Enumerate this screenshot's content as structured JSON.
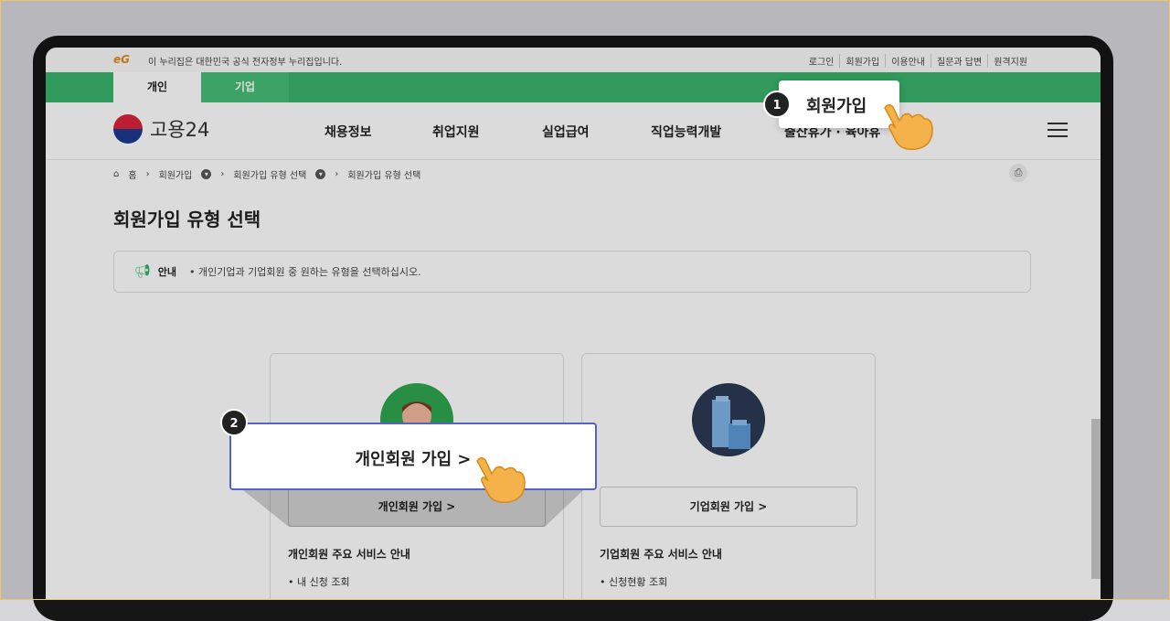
{
  "gov_bar": {
    "logo": "eG",
    "text": "이 누리집은 대한민국 공식 전자정부 누리집입니다.",
    "utility_links": [
      "로그인",
      "회원가입",
      "이용안내",
      "질문과 답변",
      "원격지원"
    ]
  },
  "tabs": [
    {
      "label": "개인",
      "active": true
    },
    {
      "label": "기업",
      "active": false
    }
  ],
  "brand": {
    "name": "고용24"
  },
  "nav": [
    "채용정보",
    "취업지원",
    "실업급여",
    "직업능력개발",
    "출산휴가 · 육아휴"
  ],
  "breadcrumb": [
    "홈",
    "회원가입",
    "회원가입 유형 선택",
    "회원가입 유형 선택"
  ],
  "page_title": "회원가입 유형 선택",
  "notice": {
    "label": "안내",
    "text": "• 개인기업과 기업회원 중 원하는 유형을 선택하십시오."
  },
  "cards": [
    {
      "button": "개인회원 가입 >",
      "service_title": "개인회원 주요 서비스 안내",
      "service_item": "• 내 신청 조회"
    },
    {
      "button": "기업회원 가입 >",
      "service_title": "기업회원 주요 서비스 안내",
      "service_item": "• 신청현황 조회"
    }
  ],
  "callouts": [
    {
      "step": "1",
      "text": "회원가입"
    },
    {
      "step": "2",
      "text": "개인회원 가입 >"
    }
  ],
  "colors": {
    "brand_green": "#38b36a",
    "callout_border": "#5563c7"
  }
}
